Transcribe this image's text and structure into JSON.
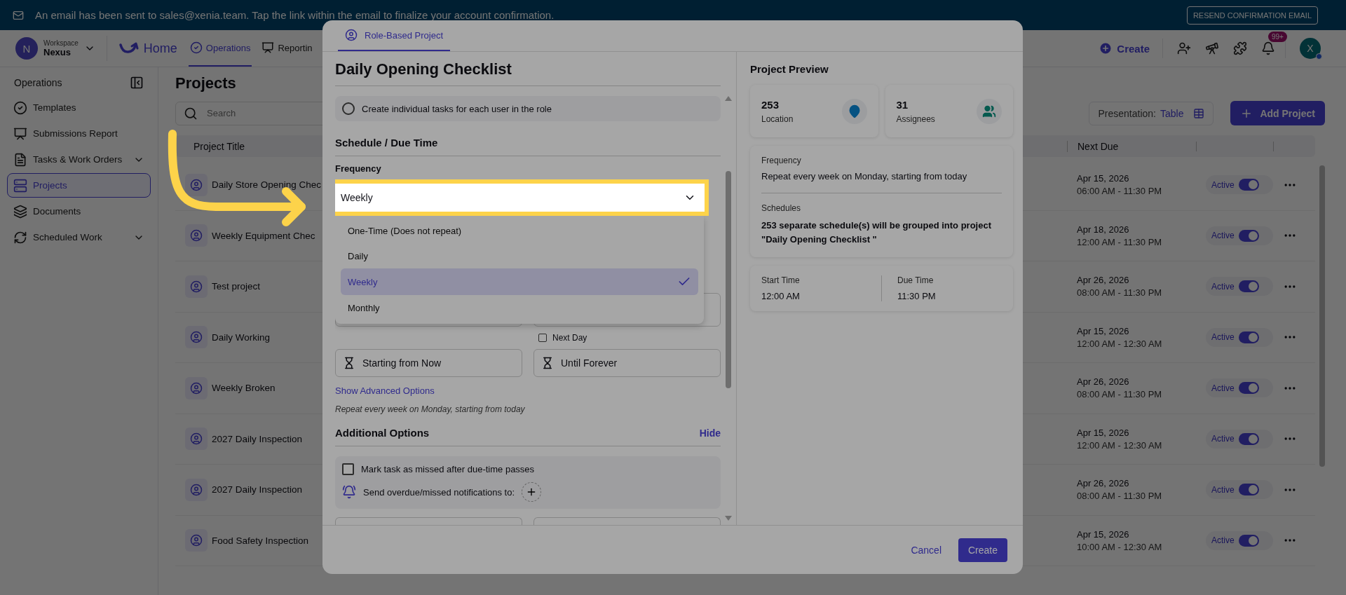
{
  "banner": {
    "message": "An email has been sent to sales@xenia.team. Tap the link within the email to finalize your account confirmation.",
    "button": "RESEND CONFIRMATION EMAIL"
  },
  "header": {
    "workspace": {
      "avatar": "N",
      "label": "Workspace",
      "name": "Nexus"
    },
    "home": "Home",
    "nav": [
      {
        "label": "Operations",
        "selected": true
      },
      {
        "label": "Reportin",
        "selected": false
      }
    ],
    "create": "Create",
    "notification_badge": "99+",
    "user_avatar": "X"
  },
  "sidebar": {
    "title": "Operations",
    "items": [
      {
        "label": "Templates",
        "expandable": false,
        "selected": false
      },
      {
        "label": "Submissions Report",
        "expandable": false,
        "selected": false
      },
      {
        "label": "Tasks & Work Orders",
        "expandable": true,
        "selected": false
      },
      {
        "label": "Projects",
        "expandable": false,
        "selected": true
      },
      {
        "label": "Documents",
        "expandable": false,
        "selected": false
      },
      {
        "label": "Scheduled Work",
        "expandable": true,
        "selected": false
      }
    ]
  },
  "page": {
    "title": "Projects",
    "search_placeholder": "Search",
    "presentation_label": "Presentation:",
    "presentation_value": "Table",
    "add_button": "Add Project",
    "columns": [
      "Project Title",
      "Next Due"
    ],
    "rows": [
      {
        "title": "Daily Store Opening Chec",
        "date": "Apr 15, 2026",
        "time": "06:00 AM - 11:30 PM",
        "status": "Active",
        "on": true
      },
      {
        "title": "Weekly Equipment Chec",
        "date": "Apr 18, 2026",
        "time": "12:00 AM - 11:30 PM",
        "status": "Active",
        "on": true
      },
      {
        "title": "Test project",
        "date": "Apr 26, 2026",
        "time": "08:00 AM - 11:30 PM",
        "status": "Active",
        "on": true
      },
      {
        "title": "Daily Working",
        "date": "Apr 15, 2026",
        "time": "12:00 AM - 12:30 AM",
        "status": "Active",
        "on": true
      },
      {
        "title": "Weekly Broken",
        "date": "Apr 26, 2026",
        "time": "08:00 AM - 11:30 PM",
        "status": "Active",
        "on": true
      },
      {
        "title": "2027 Daily Inspection",
        "date": "Apr 15, 2026",
        "time": "12:00 AM - 12:30 AM",
        "status": "Active",
        "on": true
      },
      {
        "title": "2027 Daily Inspection",
        "date": "Apr 26, 2026",
        "time": "08:00 AM - 11:30 PM",
        "status": "Active",
        "on": true
      },
      {
        "title": "Food Safety Inspection",
        "date": "Apr 15, 2026",
        "time": "10:00 AM - 12:30 AM",
        "status": "Active",
        "on": true
      }
    ]
  },
  "modal": {
    "tab": "Role-Based Project",
    "title": "Daily Opening Checklist",
    "role_option": {
      "label": "Create individual tasks for each user in the role",
      "selected": false
    },
    "schedule_heading": "Schedule / Due Time",
    "frequency_label": "Frequency",
    "frequency_value": "Weekly",
    "frequency_options": [
      {
        "label": "One-Time (Does not repeat)",
        "selected": false
      },
      {
        "label": "Daily",
        "selected": false
      },
      {
        "label": "Weekly",
        "selected": true
      },
      {
        "label": "Monthly",
        "selected": false
      }
    ],
    "next_day": {
      "label": "Next Day",
      "checked": false
    },
    "start": "Starting from Now",
    "end": "Until Forever",
    "advanced_link": "Show Advanced Options",
    "summary": "Repeat every week on Monday, starting from today",
    "additional_heading": "Additional Options",
    "hide_link": "Hide",
    "missed": {
      "label": "Mark task as missed after due-time passes",
      "checked": false
    },
    "notify_label": "Send overdue/missed notifications to:",
    "cancel": "Cancel",
    "create": "Create"
  },
  "preview": {
    "title": "Project Preview",
    "stats": [
      {
        "value": "253",
        "label": "Location"
      },
      {
        "value": "31",
        "label": "Assignees"
      }
    ],
    "frequency_label": "Frequency",
    "frequency_text": "Repeat every week on Monday, starting from today",
    "schedules_label": "Schedules",
    "schedules_text": "253 separate schedule(s) will be grouped into project \"Daily Opening Checklist \"",
    "start_label": "Start Time",
    "start_value": "12:00 AM",
    "due_label": "Due Time",
    "due_value": "11:30 PM"
  }
}
